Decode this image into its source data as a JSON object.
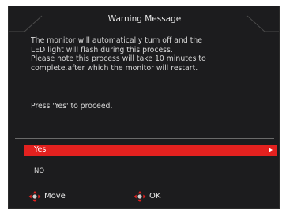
{
  "dialog": {
    "title": "Warning Message",
    "message_lines": [
      "The monitor will automatically turn off and the",
      "LED light will flash during this process.",
      "Please note this process will take 10 minutes to",
      "complete.after which the monitor will restart."
    ],
    "prompt": "Press 'Yes' to proceed.",
    "options": [
      {
        "label": "Yes",
        "selected": true
      },
      {
        "label": "NO",
        "selected": false
      }
    ],
    "footer": {
      "move_label": "Move",
      "ok_label": "OK"
    }
  },
  "colors": {
    "background": "#1c1c1e",
    "accent": "#e3211f",
    "text": "#d8d8d8",
    "divider": "#6a6a6a"
  },
  "icons": {
    "move": "four-way-arrows-icon",
    "ok": "four-way-arrows-icon",
    "selected_option": "triangle-right-icon"
  }
}
